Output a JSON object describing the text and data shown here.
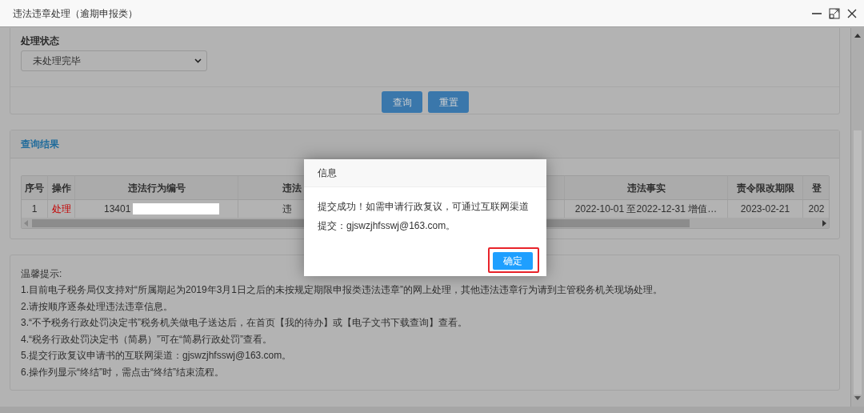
{
  "window": {
    "title": "违法违章处理（逾期申报类）"
  },
  "filter": {
    "label": "处理状态",
    "select_value": "未处理完毕",
    "buttons": [
      "查询",
      "重置"
    ]
  },
  "results": {
    "title": "查询结果",
    "columns": [
      "序号",
      "操作",
      "违法行为编号",
      "违法",
      "违法事实",
      "责令限改期限",
      "登"
    ],
    "rows": [
      {
        "cells": [
          "1",
          "处理",
          "13401",
          "违",
          "2022-10-01 至2022-12-31 增值…",
          "2023-02-21",
          "202"
        ]
      }
    ]
  },
  "tips": {
    "title": "温馨提示:",
    "lines": [
      "1.目前电子税务局仅支持对“所属期起为2019年3月1日之后的未按规定期限申报类违法违章”的网上处理，其他违法违章行为请到主管税务机关现场处理。",
      "2.请按顺序逐条处理违法违章信息。",
      "3.“不予税务行政处罚决定书”税务机关做电子送达后，在首页【我的待办】或【电子文书下载查询】查看。",
      "4.“税务行政处罚决定书（简易）”可在“简易行政处罚”查看。",
      "5.提交行政复议申请书的互联网渠道：gjswzjhfsswj@163.com。",
      "6.操作列显示“终结”时，需点击“终结”结束流程。"
    ]
  },
  "dialog": {
    "title": "信息",
    "message_lines": [
      "提交成功！如需申请行政复议，可通过互联网渠道",
      "提交：gjswzjhfsswj@163.com。"
    ],
    "button": "确定",
    "highlighted": true
  }
}
